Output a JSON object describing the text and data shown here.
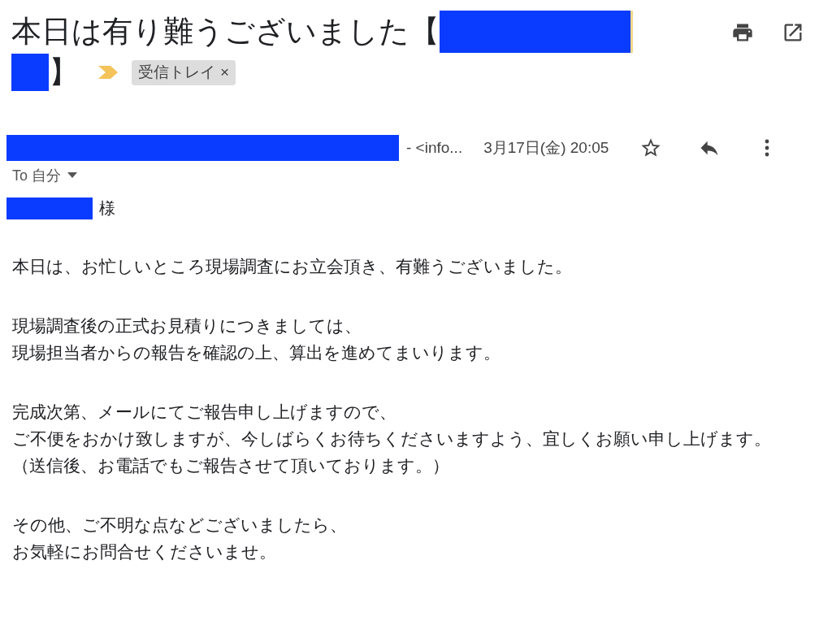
{
  "subject": {
    "before": "本日は有り難うございました【",
    "after": "】"
  },
  "label": {
    "text": "受信トレイ",
    "close": "×"
  },
  "sender": {
    "address": "- <info...",
    "date": "3月17日(金) 20:05",
    "starred": false,
    "to": "To 自分"
  },
  "salutation": "様",
  "paragraphs": [
    [
      "本日は、お忙しいところ現場調査にお立会頂き、有難うございました。"
    ],
    [
      "現場調査後の正式お見積りにつきましては、",
      "現場担当者からの報告を確認の上、算出を進めてまいります。"
    ],
    [
      "完成次第、メールにてご報告申し上げますので、",
      "ご不便をおかけ致しますが、今しばらくお待ちくださいますよう、宜しくお願い申し上げます。",
      "（送信後、お電話でもご報告させて頂いております。）"
    ],
    [
      "その他、ご不明な点などございましたら、",
      "お気軽にお問合せくださいませ。"
    ]
  ]
}
